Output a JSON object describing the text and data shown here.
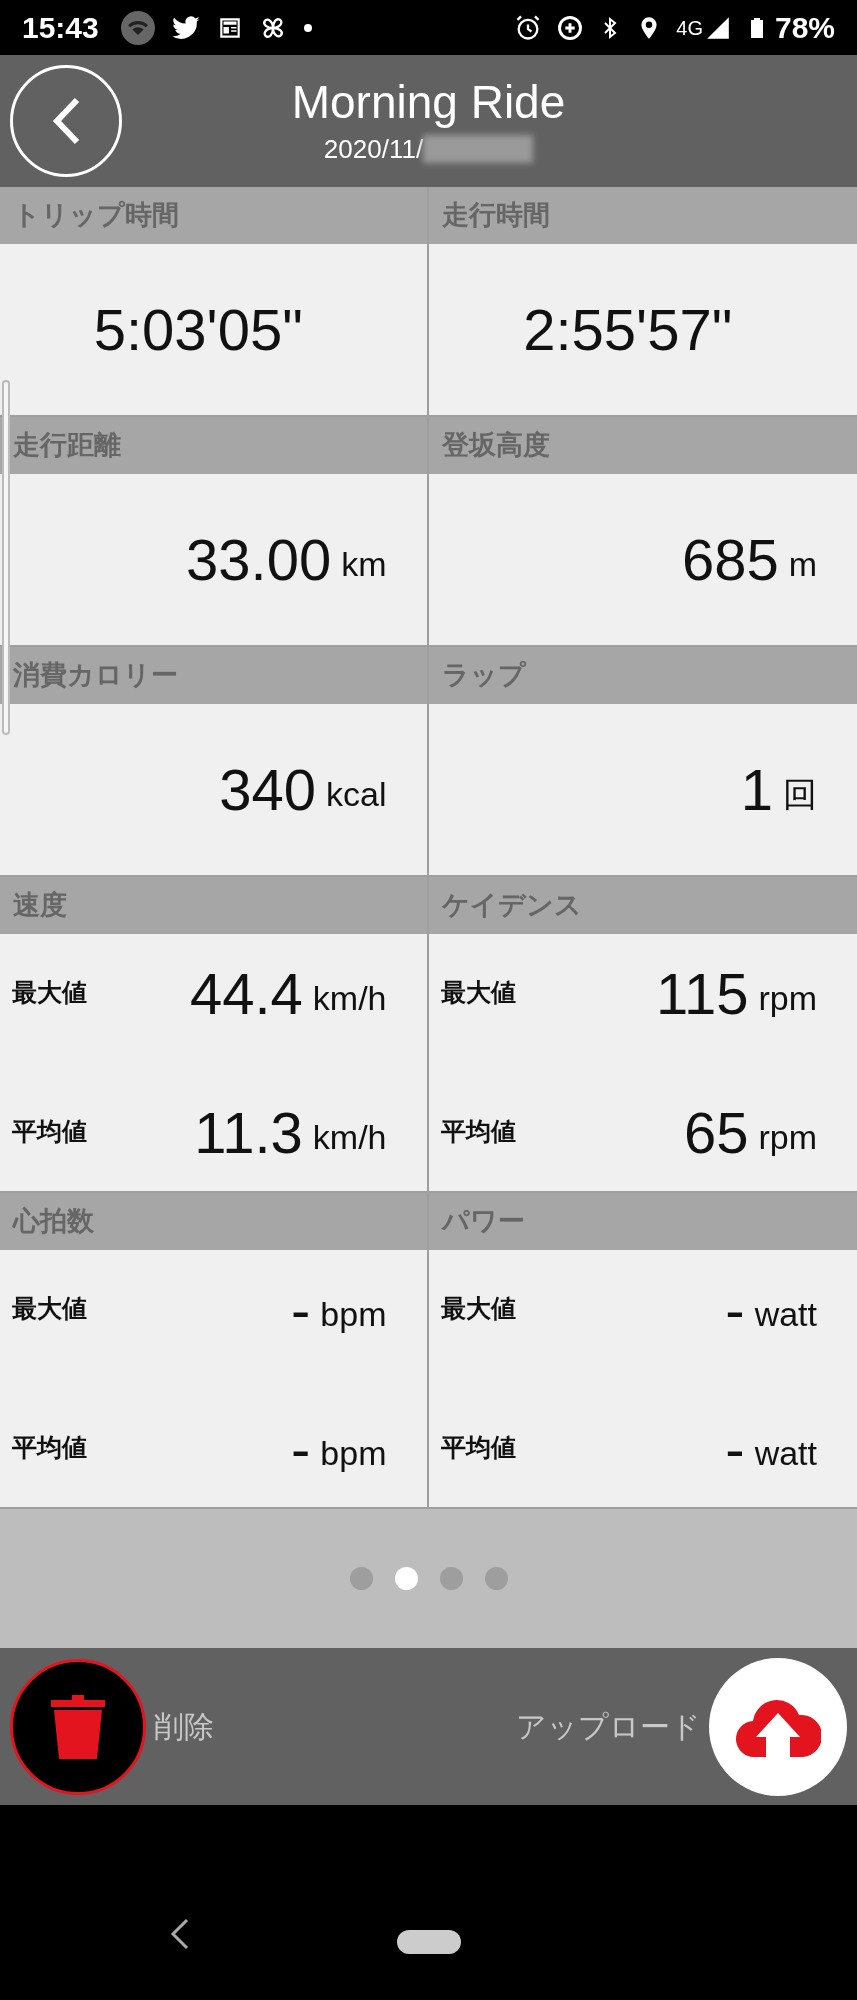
{
  "status_bar": {
    "time": "15:43",
    "network": "4G",
    "battery": "78%"
  },
  "header": {
    "title": "Morning Ride",
    "date": "2020/11/"
  },
  "sections": [
    {
      "kind": "single",
      "label": "トリップ時間",
      "value": "5:03'05\""
    },
    {
      "kind": "single",
      "label": "走行時間",
      "value": "2:55'57\""
    },
    {
      "kind": "single",
      "label": "走行距離",
      "value": "33.00",
      "unit": "km"
    },
    {
      "kind": "single",
      "label": "登坂高度",
      "value": "685",
      "unit": "m"
    },
    {
      "kind": "single",
      "label": "消費カロリー",
      "value": "340",
      "unit": "kcal"
    },
    {
      "kind": "single",
      "label": "ラップ",
      "value": "1",
      "unit": "回"
    },
    {
      "kind": "minmax",
      "label": "速度",
      "rows": [
        {
          "label": "最大値",
          "value": "44.4",
          "unit": "km/h"
        },
        {
          "label": "平均値",
          "value": "11.3",
          "unit": "km/h"
        }
      ]
    },
    {
      "kind": "minmax",
      "label": "ケイデンス",
      "rows": [
        {
          "label": "最大値",
          "value": "115",
          "unit": "rpm"
        },
        {
          "label": "平均値",
          "value": "65",
          "unit": "rpm"
        }
      ]
    },
    {
      "kind": "minmax",
      "label": "心拍数",
      "rows": [
        {
          "label": "最大値",
          "value": "-",
          "unit": "bpm"
        },
        {
          "label": "平均値",
          "value": "-",
          "unit": "bpm"
        }
      ]
    },
    {
      "kind": "minmax",
      "label": "パワー",
      "rows": [
        {
          "label": "最大値",
          "value": "-",
          "unit": "watt"
        },
        {
          "label": "平均値",
          "value": "-",
          "unit": "watt"
        }
      ]
    }
  ],
  "pager": [
    {
      "selected": false
    },
    {
      "selected": true
    },
    {
      "selected": false
    },
    {
      "selected": false
    }
  ],
  "actions": {
    "delete": "削除",
    "upload": "アップロード"
  }
}
